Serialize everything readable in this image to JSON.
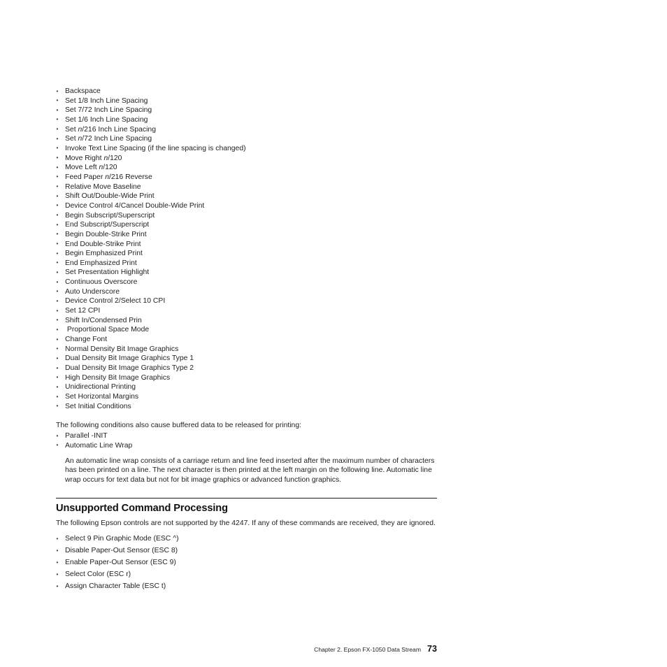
{
  "document": {
    "buffered_commands": [
      {
        "text": "Backspace"
      },
      {
        "text": "Set 1/8 Inch Line Spacing"
      },
      {
        "text": "Set 7/72 Inch Line Spacing"
      },
      {
        "text": "Set 1/6 Inch Line Spacing"
      },
      {
        "pre": "Set ",
        "italic": "n",
        "post": "/216 Inch Line Spacing"
      },
      {
        "pre": "Set ",
        "italic": "n",
        "post": "/72 Inch Line Spacing"
      },
      {
        "text": "Invoke Text Line Spacing (if the line spacing is changed)"
      },
      {
        "pre": "Move Right ",
        "italic": "n",
        "post": "/120"
      },
      {
        "pre": "Move Left ",
        "italic": "n",
        "post": "/120"
      },
      {
        "pre": "Feed Paper ",
        "italic": "n",
        "post": "/216 Reverse"
      },
      {
        "text": "Relative Move Baseline"
      },
      {
        "text": "Shift Out/Double-Wide Print"
      },
      {
        "text": "Device Control 4/Cancel Double-Wide Print"
      },
      {
        "text": "Begin Subscript/Superscript"
      },
      {
        "text": "End Subscript/Superscript"
      },
      {
        "text": "Begin Double-Strike Print"
      },
      {
        "text": "End Double-Strike Print"
      },
      {
        "text": "Begin Emphasized Print"
      },
      {
        "text": "End Emphasized Print"
      },
      {
        "text": "Set Presentation Highlight"
      },
      {
        "text": "Continuous Overscore"
      },
      {
        "text": "Auto Underscore"
      },
      {
        "text": "Device Control 2/Select 10 CPI"
      },
      {
        "text": "Set 12 CPI"
      },
      {
        "text": "Shift In/Condensed Prin"
      },
      {
        "text": " Proportional Space Mode"
      },
      {
        "text": "Change Font"
      },
      {
        "text": "Normal Density Bit Image Graphics"
      },
      {
        "text": "Dual Density Bit Image Graphics Type 1"
      },
      {
        "text": "Dual Density Bit Image Graphics Type 2"
      },
      {
        "text": "High Density Bit Image Graphics"
      },
      {
        "text": "Unidirectional Printing"
      },
      {
        "text": "Set Horizontal Margins"
      },
      {
        "text": "Set Initial Conditions"
      }
    ],
    "buffered_release": {
      "intro": "The following conditions also cause buffered data to be released for printing:",
      "items": [
        "Parallel -INIT",
        "Automatic Line Wrap"
      ],
      "note": "An automatic line wrap consists of a carriage return and line feed inserted after the maximum number of characters has been printed on a line. The next character is then printed at the left margin on the following line. Automatic line wrap occurs for text data but not for bit image graphics or advanced function graphics."
    },
    "unsupported": {
      "heading": "Unsupported Command Processing",
      "intro": "The following Epson controls are not supported by the 4247. If any of these commands are received, they are ignored.",
      "items": [
        "Select 9 Pin Graphic Mode (ESC ^)",
        "Disable Paper-Out Sensor (ESC 8)",
        "Enable Paper-Out Sensor (ESC 9)",
        "Select Color (ESC r)",
        "Assign Character Table (ESC t)"
      ]
    },
    "footer": {
      "chapter": "Chapter 2. Epson FX-1050 Data Stream",
      "page_number": "73"
    },
    "colors": {
      "text": "#222222",
      "heading": "#111111",
      "rule": "#1b1b1b",
      "background": "#ffffff"
    }
  }
}
